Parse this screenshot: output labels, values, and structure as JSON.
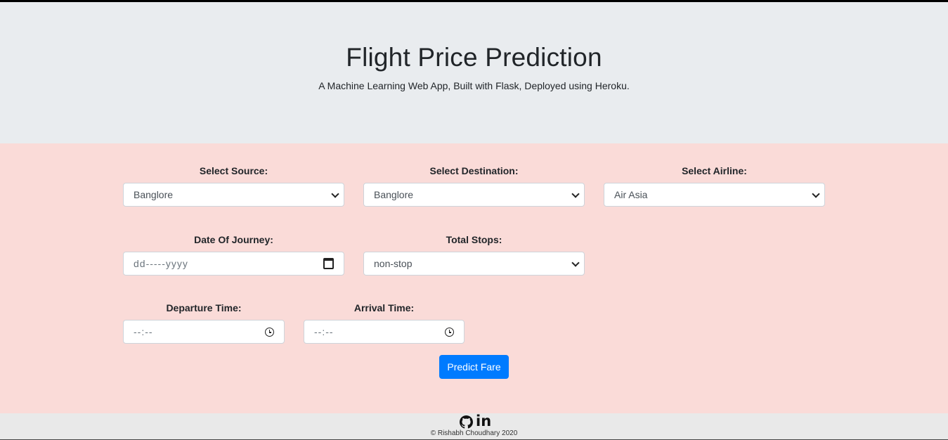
{
  "header": {
    "title": "Flight Price Prediction",
    "subtitle": "A Machine Learning Web App, Built with Flask, Deployed using Heroku."
  },
  "form": {
    "source": {
      "label": "Select Source:",
      "value": "Banglore"
    },
    "destination": {
      "label": "Select Destination:",
      "value": "Banglore"
    },
    "airline": {
      "label": "Select Airline:",
      "value": "Air Asia"
    },
    "date": {
      "label": "Date Of Journey:",
      "placeholder": "dd-----yyyy"
    },
    "stops": {
      "label": "Total Stops:",
      "value": "non-stop"
    },
    "departure": {
      "label": "Departure Time:",
      "placeholder": "--:--"
    },
    "arrival": {
      "label": "Arrival Time:",
      "placeholder": "--:--"
    },
    "submit_label": "Predict Fare"
  },
  "footer": {
    "icons": [
      "github-icon",
      "linkedin-icon"
    ],
    "linkedin_text": "in",
    "copyright": "© Rishabh Choudhary 2020"
  },
  "colors": {
    "header_bg": "#e9ecef",
    "form_bg": "#fadbd8",
    "button": "#007bff",
    "footer_bg": "#e9e9e9"
  }
}
